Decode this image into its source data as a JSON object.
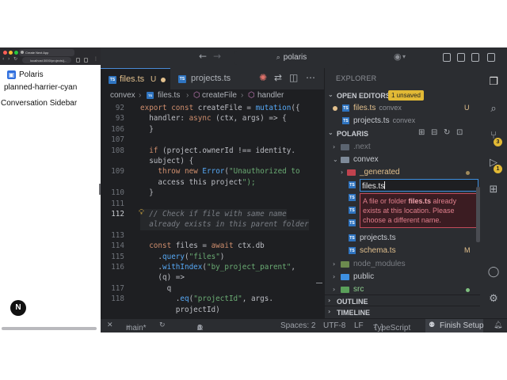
{
  "browser": {
    "tab_title": "Create Next App",
    "url": "localhost:3000/projects/j..."
  },
  "app": {
    "brand": "Polaris",
    "project_name": "planned-harrier-cyan",
    "sidebar_title": "Conversation Sidebar",
    "next_badge": "N"
  },
  "titlebar": {
    "search": "polaris"
  },
  "tabs": [
    {
      "label": "files.ts",
      "status": "U",
      "modified": true,
      "active": true
    },
    {
      "label": "projects.ts",
      "status": "",
      "modified": false,
      "active": false
    }
  ],
  "breadcrumb": [
    "convex",
    "files.ts",
    "createFile",
    "handler"
  ],
  "code": {
    "lines": [
      {
        "n": "92",
        "text": "export const createFile = mutation({"
      },
      {
        "n": "93",
        "text": "  handler: async (ctx, args) => {"
      },
      {
        "n": "106",
        "text": "  }"
      },
      {
        "n": "107",
        "text": ""
      },
      {
        "n": "108",
        "text": "  if (project.ownerId !== identity."
      },
      {
        "n": "",
        "text": "  subject) {"
      },
      {
        "n": "109",
        "text": "    throw new Error(\"Unauthorized to"
      },
      {
        "n": "",
        "text": "    access this project\");"
      },
      {
        "n": "110",
        "text": "  }"
      },
      {
        "n": "111",
        "text": ""
      },
      {
        "n": "112",
        "text": "  // Check if file with same name"
      },
      {
        "n": "",
        "text": "  already exists in this parent folder"
      },
      {
        "n": "113",
        "text": ""
      },
      {
        "n": "114",
        "text": "  const files = await ctx.db"
      },
      {
        "n": "115",
        "text": "    .query(\"files\")"
      },
      {
        "n": "116",
        "text": "    .withIndex(\"by_project_parent\","
      },
      {
        "n": "",
        "text": "    (q) =>"
      },
      {
        "n": "117",
        "text": "      q"
      },
      {
        "n": "118",
        "text": "        .eq(\"projectId\", args."
      },
      {
        "n": "",
        "text": "        projectId)"
      }
    ],
    "current_line": "112"
  },
  "explorer": {
    "title": "EXPLORER",
    "open_editors_label": "OPEN EDITORS",
    "unsaved_badge": "1 unsaved",
    "open_editors": [
      {
        "name": "files.ts",
        "dir": "convex",
        "status": "U",
        "modified": true
      },
      {
        "name": "projects.ts",
        "dir": "convex",
        "status": "",
        "modified": false
      }
    ],
    "workspace_label": "POLARIS",
    "tree": {
      "next": ".next",
      "convex": "convex",
      "generated": "_generated",
      "rename_value": "files.ts",
      "projects": "projects.ts",
      "schema": "schema.ts",
      "schema_status": "M",
      "node_modules": "node_modules",
      "public": "public",
      "src": "src"
    },
    "error": {
      "prefix": "A file or folder ",
      "name": "files.ts",
      "suffix": " already exists at this location. Please choose a different name."
    },
    "outline_label": "OUTLINE",
    "timeline_label": "TIMELINE"
  },
  "activity": {
    "scm_badge": "3",
    "run_badge": "1"
  },
  "statusbar": {
    "branch": "main*",
    "errors": "0",
    "warnings": "4",
    "spaces": "Spaces: 2",
    "encoding": "UTF-8",
    "eol": "LF",
    "language": "TypeScript",
    "finish": "Finish Setup"
  },
  "colors": {
    "accent": "#3d8fe0",
    "warning_badge": "#e2b935",
    "error_border": "#c24b5a"
  }
}
